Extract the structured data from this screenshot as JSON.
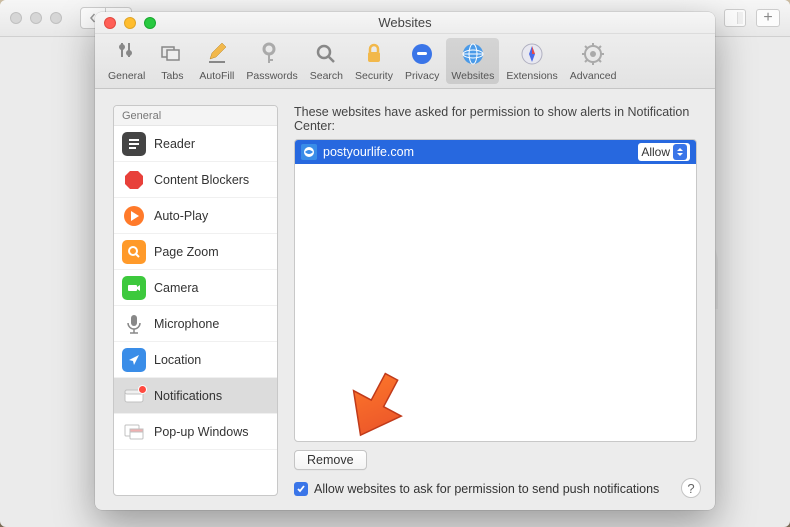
{
  "window": {
    "title": "Websites"
  },
  "toolbar": {
    "items": [
      {
        "label": "General"
      },
      {
        "label": "Tabs"
      },
      {
        "label": "AutoFill"
      },
      {
        "label": "Passwords"
      },
      {
        "label": "Search"
      },
      {
        "label": "Security"
      },
      {
        "label": "Privacy"
      },
      {
        "label": "Websites"
      },
      {
        "label": "Extensions"
      },
      {
        "label": "Advanced"
      }
    ]
  },
  "sidebar": {
    "header": "General",
    "items": [
      {
        "label": "Reader"
      },
      {
        "label": "Content Blockers"
      },
      {
        "label": "Auto-Play"
      },
      {
        "label": "Page Zoom"
      },
      {
        "label": "Camera"
      },
      {
        "label": "Microphone"
      },
      {
        "label": "Location"
      },
      {
        "label": "Notifications"
      },
      {
        "label": "Pop-up Windows"
      }
    ]
  },
  "main": {
    "header": "These websites have asked for permission to show alerts in Notification Center:",
    "websites": [
      {
        "name": "postyourlife.com",
        "permission": "Allow"
      }
    ],
    "remove_label": "Remove",
    "checkbox_label": "Allow websites to ask for permission to send push notifications",
    "checkbox_checked": true
  },
  "help": "?"
}
